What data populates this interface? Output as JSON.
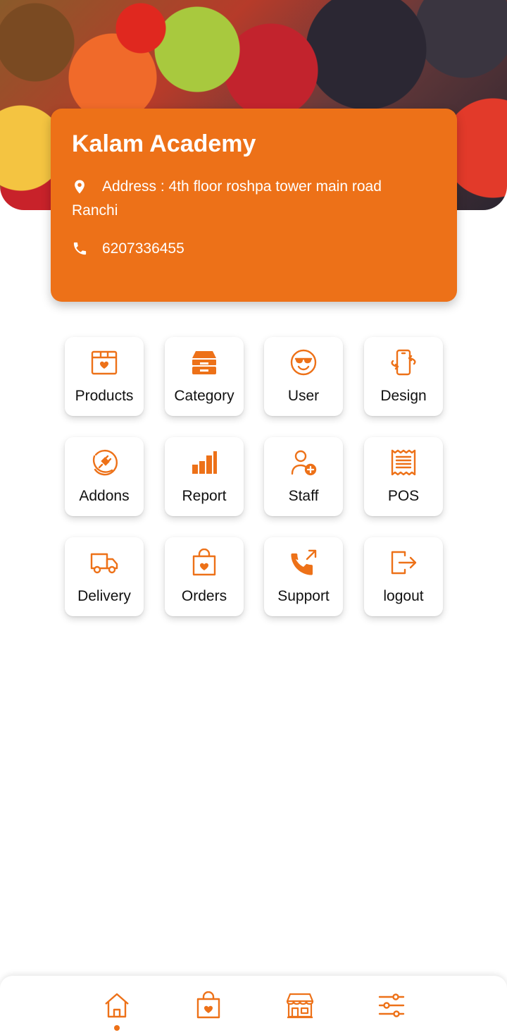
{
  "shop": {
    "name": "Kalam Academy",
    "address_line1": "Address : 4th floor roshpa tower main road",
    "address_line2": "Ranchi",
    "phone": "6207336455"
  },
  "menu": [
    {
      "label": "Products",
      "icon": "product-box-icon"
    },
    {
      "label": "Category",
      "icon": "category-tray-icon"
    },
    {
      "label": "User",
      "icon": "user-smiley-icon"
    },
    {
      "label": "Design",
      "icon": "phone-rotate-icon"
    },
    {
      "label": "Addons",
      "icon": "plug-icon"
    },
    {
      "label": "Report",
      "icon": "bar-chart-icon"
    },
    {
      "label": "Staff",
      "icon": "user-add-icon"
    },
    {
      "label": "POS",
      "icon": "receipt-icon"
    },
    {
      "label": "Delivery",
      "icon": "truck-icon"
    },
    {
      "label": "Orders",
      "icon": "shopping-bag-icon"
    },
    {
      "label": "Support",
      "icon": "phone-call-icon"
    },
    {
      "label": "logout",
      "icon": "logout-icon"
    }
  ],
  "bottom_nav": [
    "home-icon",
    "bag-icon",
    "store-icon",
    "settings-sliders-icon"
  ],
  "colors": {
    "accent": "#ed7118",
    "text": "#111111"
  }
}
